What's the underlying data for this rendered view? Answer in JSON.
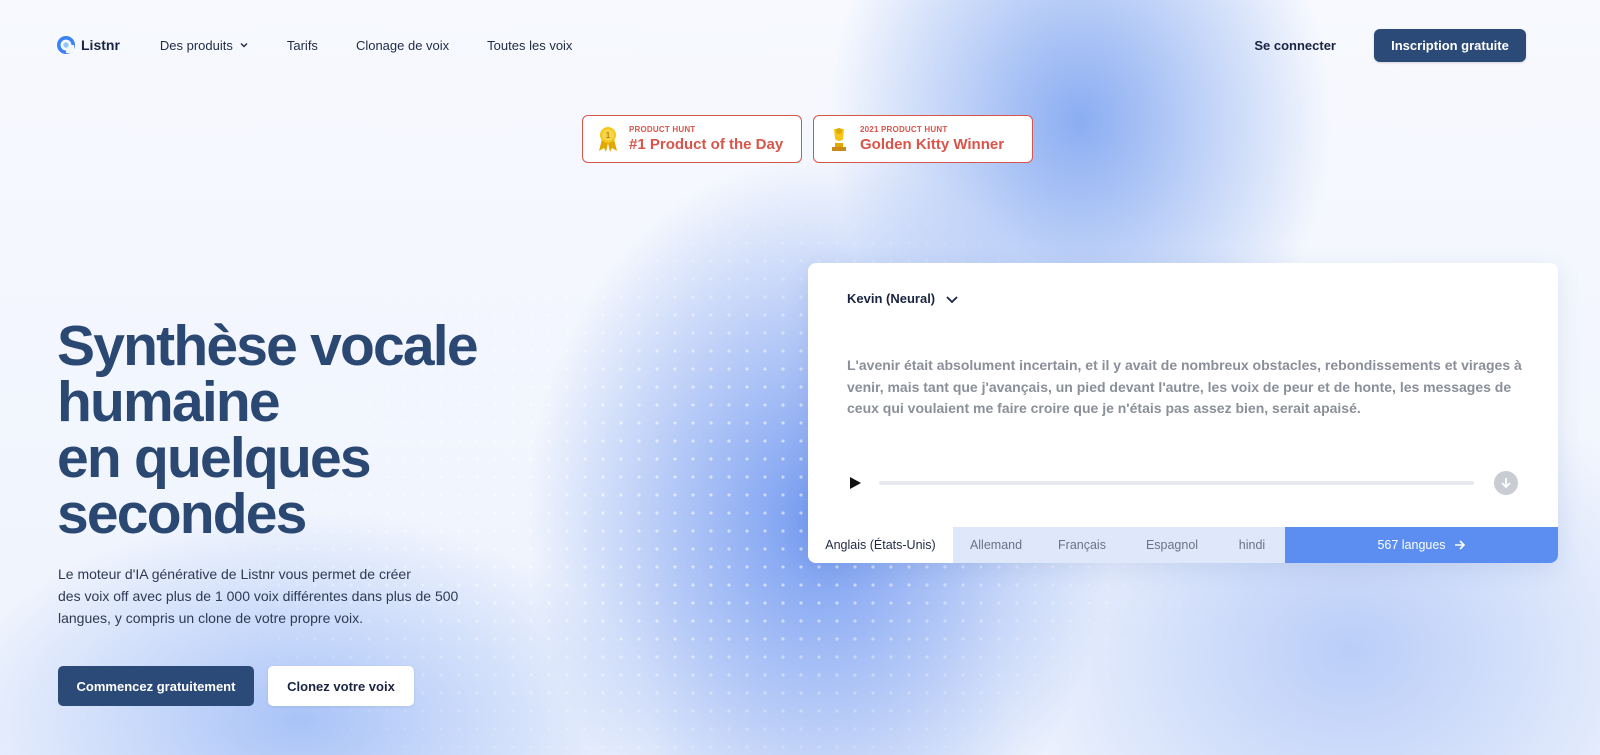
{
  "nav": {
    "brand": "Listnr",
    "links": [
      "Des produits",
      "Tarifs",
      "Clonage de voix",
      "Toutes les voix"
    ],
    "login": "Se connecter",
    "signup": "Inscription gratuite"
  },
  "badges": [
    {
      "small": "PRODUCT HUNT",
      "big": "#1 Product of the Day",
      "icon": "medal-icon"
    },
    {
      "small": "2021 PRODUCT HUNT",
      "big": "Golden Kitty Winner",
      "icon": "trophy-icon"
    }
  ],
  "hero": {
    "title_lines": [
      "Synthèse vocale",
      "humaine",
      "en quelques",
      "secondes"
    ],
    "description_lines": [
      "Le moteur d'IA générative de Listnr vous permet de créer",
      "des voix off avec plus de 1 000 voix différentes dans plus de 500",
      "langues, y compris un clone de votre propre voix."
    ],
    "cta_primary": "Commencez gratuitement",
    "cta_secondary": "Clonez votre voix"
  },
  "player": {
    "voice": "Kevin (Neural)",
    "sample_text": "L'avenir était absolument incertain, et il y avait de nombreux obstacles, rebondissements et virages à venir, mais tant que j'avançais, un pied devant l'autre, les voix de peur et de honte, les messages de ceux qui voulaient me faire croire que je n'étais pas assez bien, serait apaisé.",
    "progress": 0,
    "languages": [
      "Anglais (États-Unis)",
      "Allemand",
      "Français",
      "Espagnol",
      "hindi"
    ],
    "more_languages": "567 langues"
  },
  "colors": {
    "primary": "#2b4a78",
    "accent": "#5b8ef0",
    "badge": "#d9544a"
  }
}
